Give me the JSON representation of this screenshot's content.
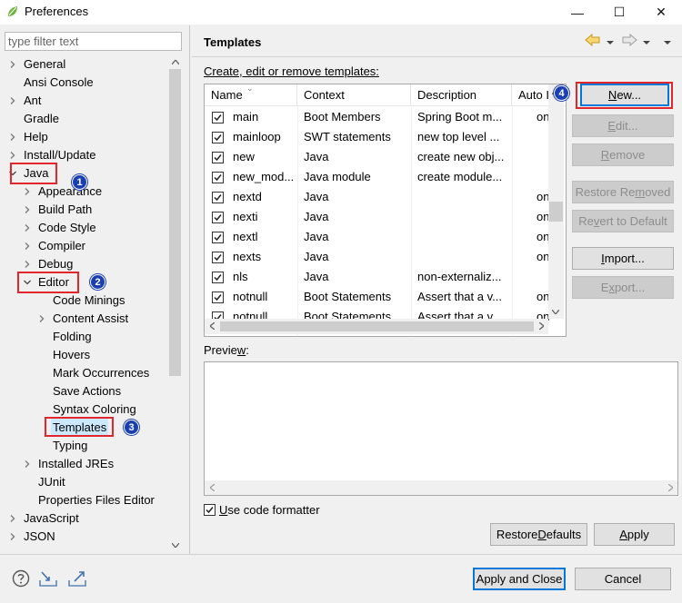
{
  "window": {
    "title": "Preferences",
    "minimize": "—",
    "maximize": "☐",
    "close": "✕"
  },
  "filter": {
    "placeholder": "type filter text",
    "value": ""
  },
  "tree": [
    {
      "label": "General",
      "depth": 0,
      "state": "collapsed"
    },
    {
      "label": "Ansi Console",
      "depth": 0,
      "state": "leaf"
    },
    {
      "label": "Ant",
      "depth": 0,
      "state": "collapsed"
    },
    {
      "label": "Gradle",
      "depth": 0,
      "state": "leaf"
    },
    {
      "label": "Help",
      "depth": 0,
      "state": "collapsed"
    },
    {
      "label": "Install/Update",
      "depth": 0,
      "state": "collapsed"
    },
    {
      "label": "Java",
      "depth": 0,
      "state": "expanded"
    },
    {
      "label": "Appearance",
      "depth": 1,
      "state": "collapsed"
    },
    {
      "label": "Build Path",
      "depth": 1,
      "state": "collapsed"
    },
    {
      "label": "Code Style",
      "depth": 1,
      "state": "collapsed"
    },
    {
      "label": "Compiler",
      "depth": 1,
      "state": "collapsed"
    },
    {
      "label": "Debug",
      "depth": 1,
      "state": "collapsed"
    },
    {
      "label": "Editor",
      "depth": 1,
      "state": "expanded"
    },
    {
      "label": "Code Minings",
      "depth": 2,
      "state": "leaf"
    },
    {
      "label": "Content Assist",
      "depth": 2,
      "state": "collapsed"
    },
    {
      "label": "Folding",
      "depth": 2,
      "state": "leaf"
    },
    {
      "label": "Hovers",
      "depth": 2,
      "state": "leaf"
    },
    {
      "label": "Mark Occurrences",
      "depth": 2,
      "state": "leaf"
    },
    {
      "label": "Save Actions",
      "depth": 2,
      "state": "leaf"
    },
    {
      "label": "Syntax Coloring",
      "depth": 2,
      "state": "leaf"
    },
    {
      "label": "Templates",
      "depth": 2,
      "state": "leaf",
      "selected": true
    },
    {
      "label": "Typing",
      "depth": 2,
      "state": "leaf"
    },
    {
      "label": "Installed JREs",
      "depth": 1,
      "state": "collapsed"
    },
    {
      "label": "JUnit",
      "depth": 1,
      "state": "leaf"
    },
    {
      "label": "Properties Files Editor",
      "depth": 1,
      "state": "leaf"
    },
    {
      "label": "JavaScript",
      "depth": 0,
      "state": "collapsed"
    },
    {
      "label": "JSON",
      "depth": 0,
      "state": "collapsed"
    }
  ],
  "annotations": [
    "1",
    "2",
    "3",
    "4"
  ],
  "page": {
    "title": "Templates",
    "description": "Create, edit or remove templates:",
    "columns": [
      "Name",
      "Context",
      "Description",
      "Auto I"
    ],
    "rows": [
      {
        "name": "main",
        "context": "Boot Members",
        "description": "Spring Boot m...",
        "auto": "on"
      },
      {
        "name": "mainloop",
        "context": "SWT statements",
        "description": "new top level ...",
        "auto": ""
      },
      {
        "name": "new",
        "context": "Java",
        "description": "create new obj...",
        "auto": ""
      },
      {
        "name": "new_mod...",
        "context": "Java module",
        "description": "create module...",
        "auto": ""
      },
      {
        "name": "nextd",
        "context": "Java",
        "description": "",
        "auto": "on"
      },
      {
        "name": "nexti",
        "context": "Java",
        "description": "",
        "auto": "on"
      },
      {
        "name": "nextl",
        "context": "Java",
        "description": "",
        "auto": "on"
      },
      {
        "name": "nexts",
        "context": "Java",
        "description": "",
        "auto": "on"
      },
      {
        "name": "nls",
        "context": "Java",
        "description": "non-externaliz...",
        "auto": ""
      },
      {
        "name": "notnull",
        "context": "Boot Statements",
        "description": "Assert that a v...",
        "auto": "on"
      },
      {
        "name": "notnull",
        "context": "Boot Statements",
        "description": "Assert that a v...",
        "auto": "on"
      }
    ],
    "buttons": {
      "new": {
        "pre": "",
        "u": "N",
        "post": "ew..."
      },
      "edit": {
        "pre": "",
        "u": "E",
        "post": "dit..."
      },
      "remove": {
        "pre": "",
        "u": "R",
        "post": "emove"
      },
      "restore_removed": {
        "pre": "Restore Re",
        "u": "m",
        "post": "oved"
      },
      "revert": {
        "pre": "Re",
        "u": "v",
        "post": "ert to Default"
      },
      "import": {
        "pre": "",
        "u": "I",
        "post": "mport..."
      },
      "export": {
        "pre": "E",
        "u": "x",
        "post": "port..."
      }
    },
    "preview": {
      "pre": "Previe",
      "u": "w",
      "post": ":"
    },
    "use_formatter": {
      "pre": "",
      "u": "U",
      "post": "se code formatter",
      "checked": true
    }
  },
  "footer": {
    "restore_defaults": {
      "pre": "Restore ",
      "u": "D",
      "post": "efaults"
    },
    "apply": {
      "pre": "",
      "u": "A",
      "post": "pply"
    },
    "apply_close": "Apply and Close",
    "cancel": "Cancel"
  },
  "colors": {
    "annotation_red": "#e3262b",
    "badge_blue": "#1a3fb3",
    "selection": "#cce8ff",
    "primary_border": "#0078d7"
  }
}
